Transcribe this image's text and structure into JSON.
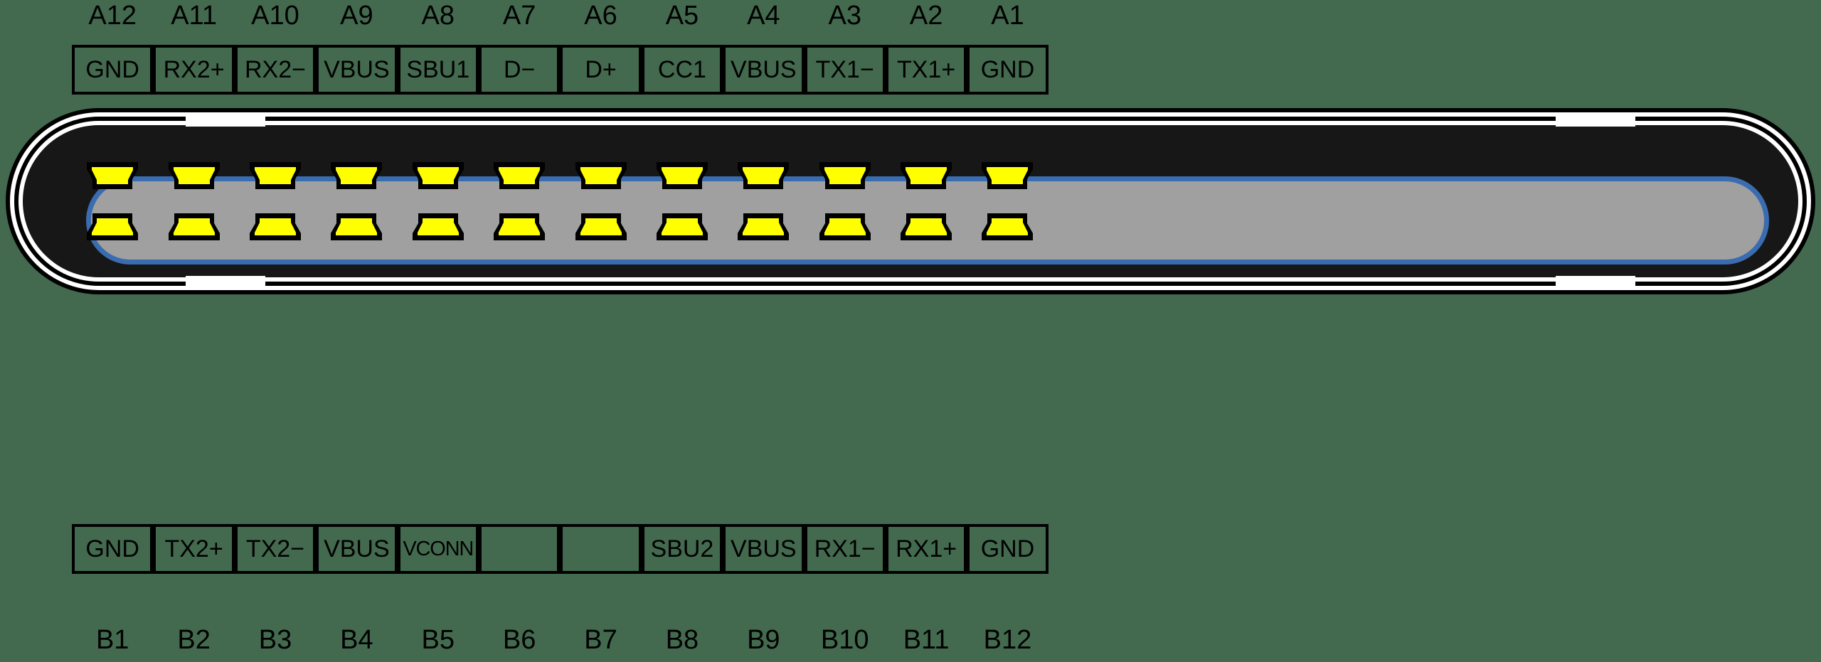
{
  "diagram": {
    "type": "usb-c-receptacle-pinout",
    "colors": {
      "background": "#436a4f",
      "shell_outline": "#000000",
      "shell_body": "#171717",
      "cavity_fill": "#a0a0a0",
      "cavity_outline": "#3a6cb0",
      "pin_fill": "#ffff00",
      "pin_outline": "#000000",
      "text": "#000000"
    }
  },
  "top_row": {
    "pin_numbers": [
      "A12",
      "A11",
      "A10",
      "A9",
      "A8",
      "A7",
      "A6",
      "A5",
      "A4",
      "A3",
      "A2",
      "A1"
    ],
    "signals": [
      "GND",
      "RX2+",
      "RX2−",
      "VBUS",
      "SBU1",
      "D−",
      "D+",
      "CC1",
      "VBUS",
      "TX1−",
      "TX1+",
      "GND"
    ]
  },
  "bottom_row": {
    "pin_numbers": [
      "B1",
      "B2",
      "B3",
      "B4",
      "B5",
      "B6",
      "B7",
      "B8",
      "B9",
      "B10",
      "B11",
      "B12"
    ],
    "signals": [
      "GND",
      "TX2+",
      "TX2−",
      "VBUS",
      "VCONN",
      "",
      "",
      "SBU2",
      "VBUS",
      "RX1−",
      "RX1+",
      "GND"
    ]
  },
  "contacts": {
    "top_count": 12,
    "bottom_count": 12,
    "shape": "trapezoid-contact"
  }
}
